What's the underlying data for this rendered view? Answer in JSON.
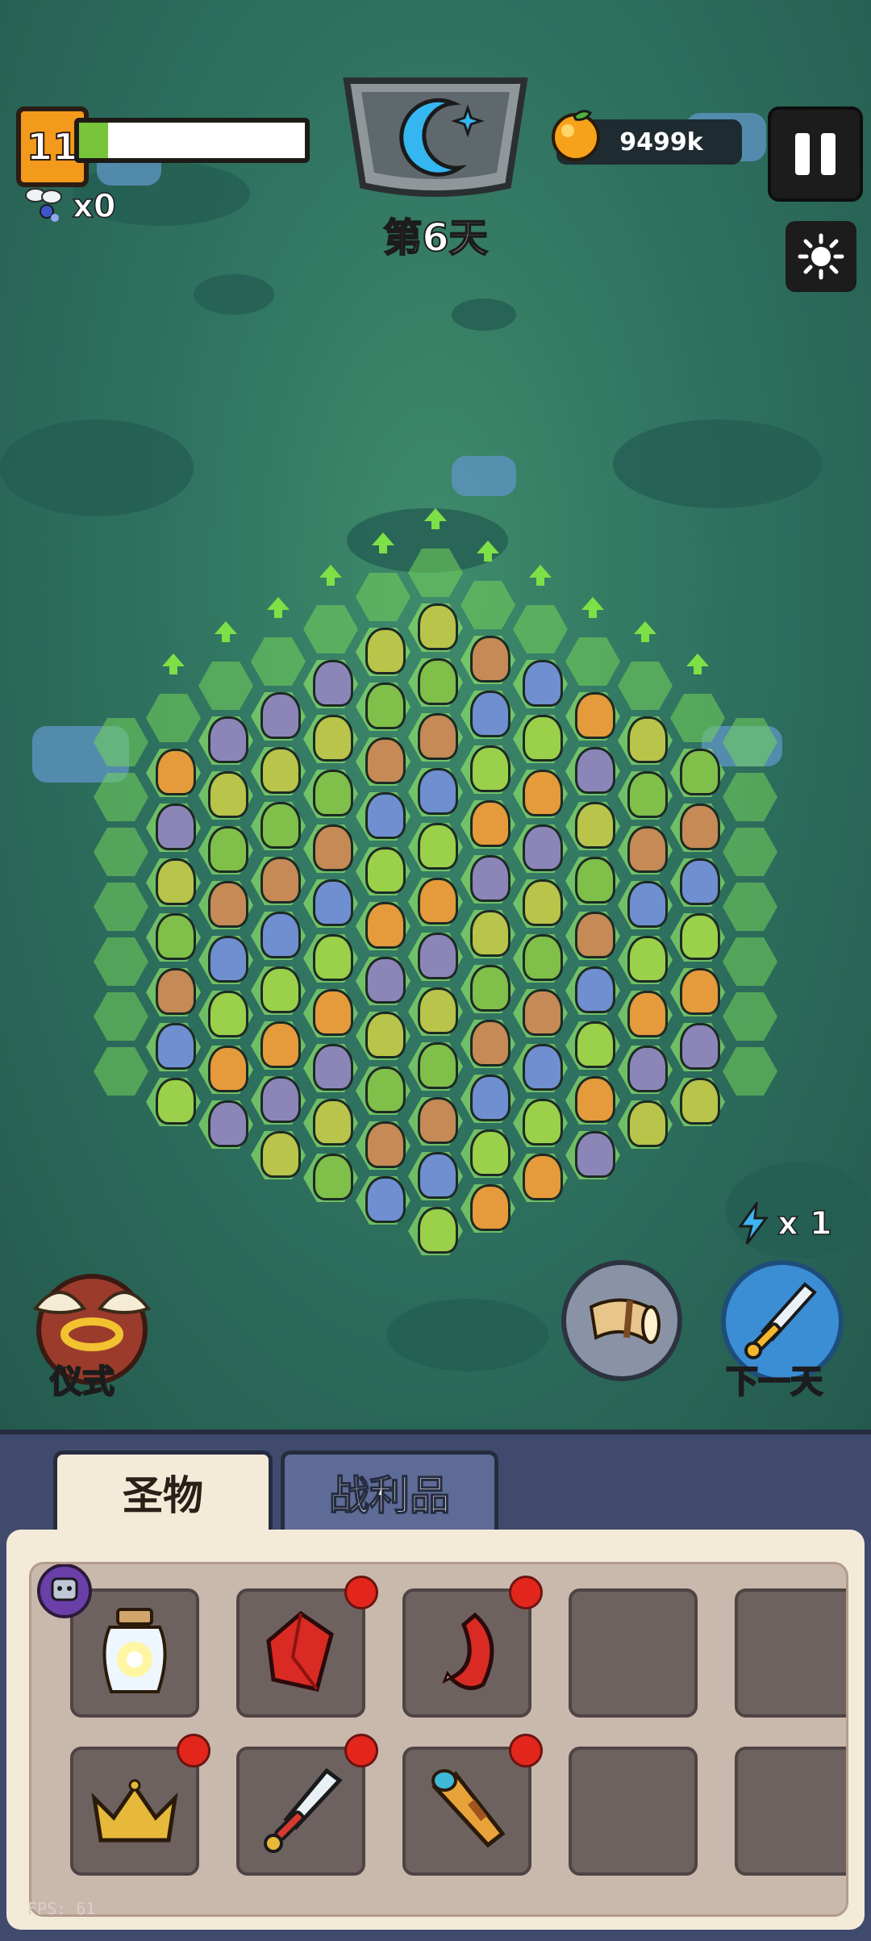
{
  "hud": {
    "level": "11",
    "xp_progress": 0.13,
    "fairy_count": "x0",
    "day_label": "第6天",
    "gold": "9499k",
    "pause_icon": "pause-icon",
    "settings_icon": "sun-icon"
  },
  "actions": {
    "ritual_label": "仪式",
    "next_day_label": "下一天",
    "energy_count": "x 1"
  },
  "inventory": {
    "tabs": [
      "圣物",
      "战利品"
    ],
    "active_tab": "圣物",
    "items": [
      {
        "icon": "light-jar-icon",
        "badge": "robot-badge"
      },
      {
        "icon": "red-gem-icon",
        "new": true
      },
      {
        "icon": "red-horn-icon",
        "new": true
      },
      {
        "icon": "",
        "empty": true
      },
      {
        "icon": "",
        "empty": true
      },
      {
        "icon": "crown-icon",
        "new": true
      },
      {
        "icon": "sword-icon",
        "new": true
      },
      {
        "icon": "spyglass-icon",
        "new": true
      },
      {
        "icon": "",
        "empty": true
      },
      {
        "icon": "",
        "empty": true
      }
    ]
  },
  "fps": "FPS: 61",
  "colors": {
    "hex_green": "#74d35a",
    "panel_bg": "#3f4a6d",
    "cream": "#f3ead8",
    "new_dot": "#e3261c"
  }
}
